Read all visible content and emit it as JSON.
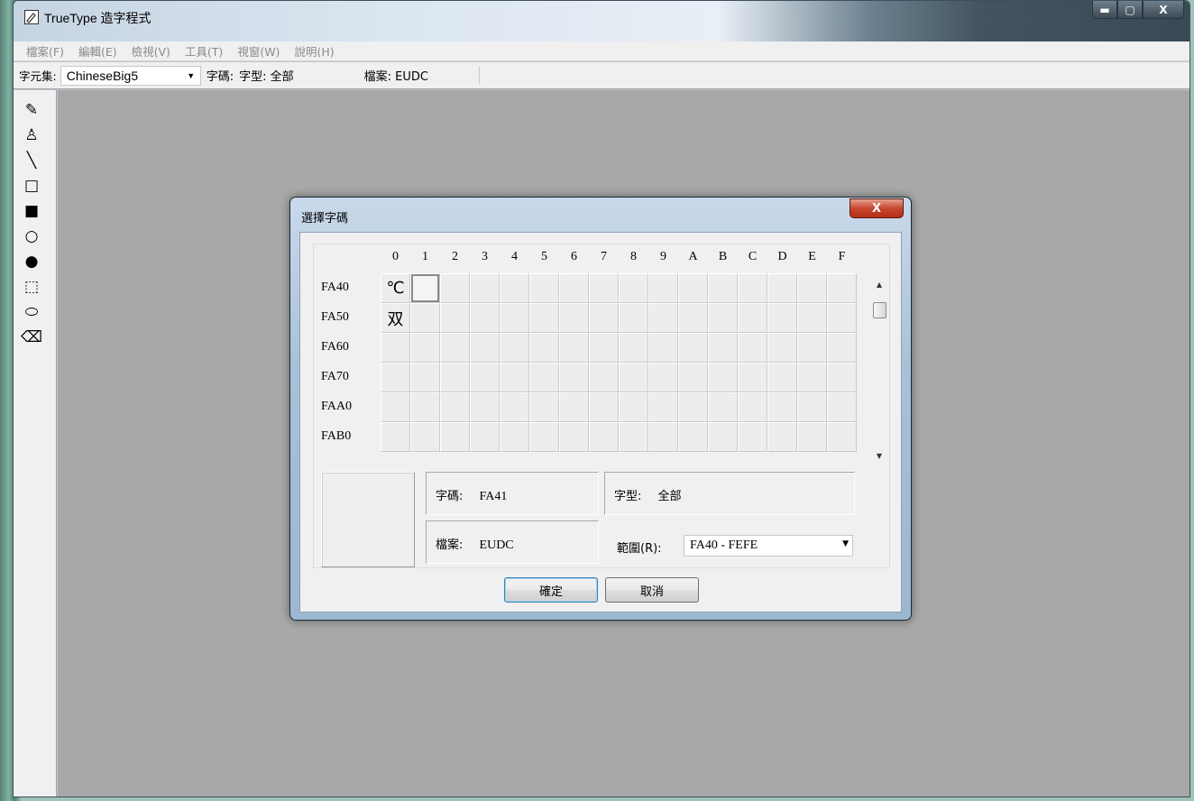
{
  "window": {
    "title": "TrueType 造字程式",
    "controls": {
      "minimize": "▬",
      "maximize": "▢",
      "close": "X"
    }
  },
  "menu": [
    {
      "label": "檔案(F)"
    },
    {
      "label": "編輯(E)"
    },
    {
      "label": "檢視(V)"
    },
    {
      "label": "工具(T)"
    },
    {
      "label": "視窗(W)"
    },
    {
      "label": "說明(H)"
    }
  ],
  "toolbar": {
    "charset_label": "字元集:",
    "charset_value": "ChineseBig5",
    "code_label": "字碼:",
    "font_label": "字型: 全部",
    "file_label": "檔案: EUDC"
  },
  "tools": [
    {
      "name": "pencil-icon",
      "glyph": "✎"
    },
    {
      "name": "brush-icon",
      "glyph": "♙"
    },
    {
      "name": "line-icon",
      "glyph": "╲"
    },
    {
      "name": "hollow-rectangle-icon",
      "glyph": "□"
    },
    {
      "name": "filled-rectangle-icon",
      "glyph": "■"
    },
    {
      "name": "hollow-ellipse-icon",
      "glyph": "○"
    },
    {
      "name": "filled-ellipse-icon",
      "glyph": "●"
    },
    {
      "name": "rect-select-icon",
      "glyph": "⬚"
    },
    {
      "name": "freeform-select-icon",
      "glyph": "⬭"
    },
    {
      "name": "eraser-icon",
      "glyph": "⌫"
    }
  ],
  "dialog": {
    "title": "選擇字碼",
    "close": "X",
    "columns": [
      "0",
      "1",
      "2",
      "3",
      "4",
      "5",
      "6",
      "7",
      "8",
      "9",
      "A",
      "B",
      "C",
      "D",
      "E",
      "F"
    ],
    "rows": [
      {
        "label": "FA40",
        "cells": [
          "℃",
          ""
        ]
      },
      {
        "label": "FA50",
        "cells": [
          "双"
        ]
      },
      {
        "label": "FA60",
        "cells": []
      },
      {
        "label": "FA70",
        "cells": []
      },
      {
        "label": "FAA0",
        "cells": []
      },
      {
        "label": "FAB0",
        "cells": []
      }
    ],
    "selected": {
      "row": 0,
      "col": 1
    },
    "code_label": "字碼:",
    "code_value": "FA41",
    "font_label": "字型:",
    "font_value": "全部",
    "file_label": "檔案:",
    "file_value": "EUDC",
    "range_label": "範圍(R):",
    "range_value": "FA40 - FEFE",
    "ok_label": "確定",
    "cancel_label": "取消"
  }
}
